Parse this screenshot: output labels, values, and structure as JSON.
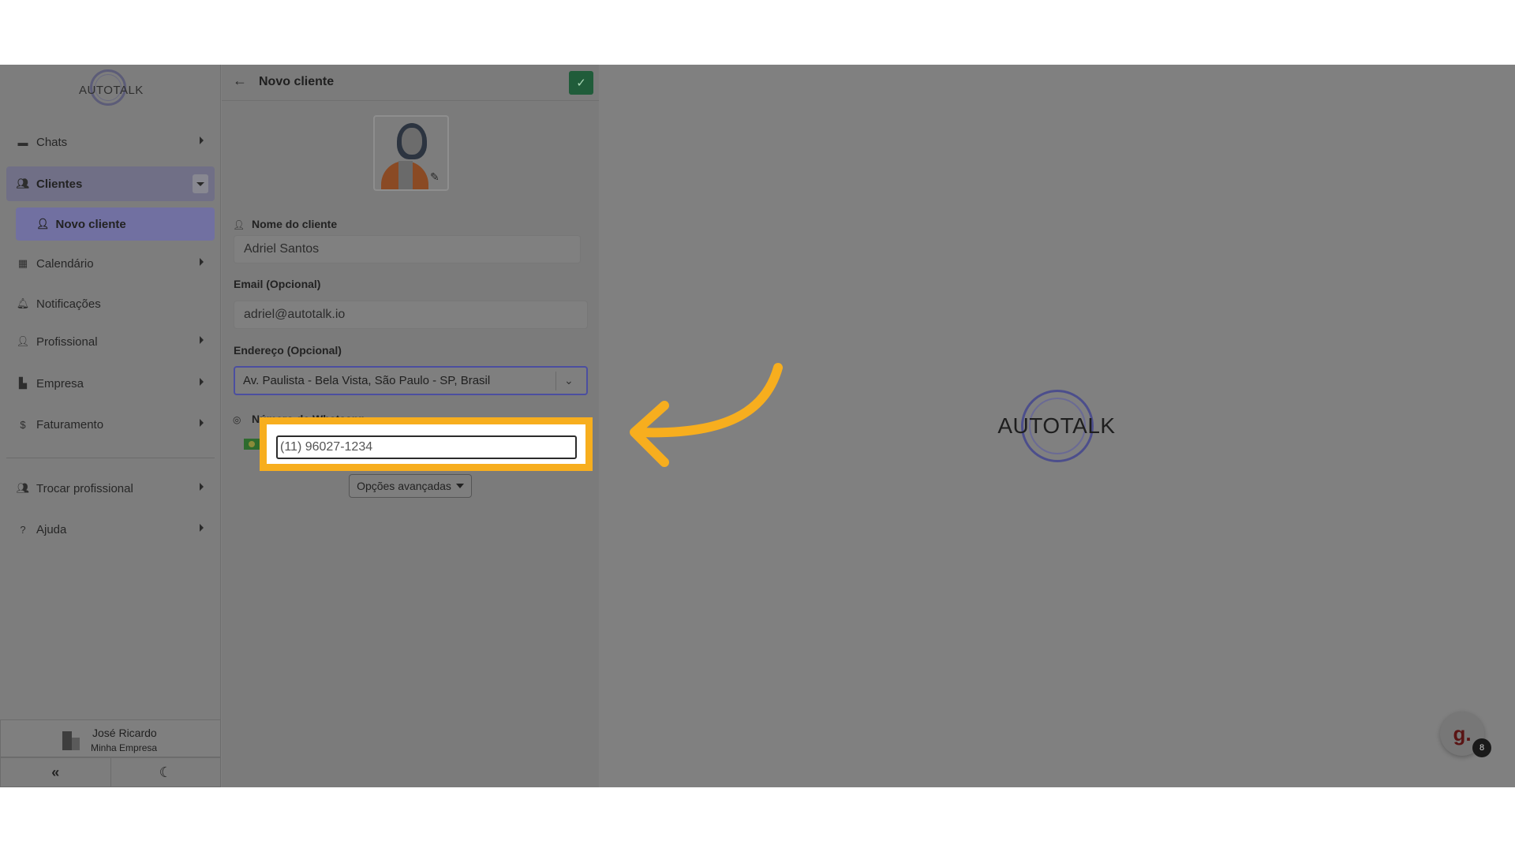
{
  "app": {
    "logo_text": "AUTOTALK"
  },
  "sidebar": {
    "items": [
      {
        "label": "Chats",
        "icon": "chat-icon"
      },
      {
        "label": "Clientes",
        "icon": "users-icon"
      },
      {
        "label": "Novo cliente",
        "icon": "user-plus-icon"
      },
      {
        "label": "Calendário",
        "icon": "calendar-icon"
      },
      {
        "label": "Notificações",
        "icon": "bell-icon"
      },
      {
        "label": "Profissional",
        "icon": "user-cog-icon"
      },
      {
        "label": "Empresa",
        "icon": "building-icon"
      },
      {
        "label": "Faturamento",
        "icon": "dollar-icon"
      },
      {
        "label": "Trocar profissional",
        "icon": "users-swap-icon"
      },
      {
        "label": "Ajuda",
        "icon": "question-icon"
      }
    ],
    "user": {
      "name": "José Ricardo",
      "company": "Minha Empresa"
    },
    "bottom": {
      "collapse_glyph": "«",
      "theme_glyph": "☾"
    }
  },
  "panel": {
    "title": "Novo cliente",
    "back_glyph": "←",
    "save_glyph": "✓",
    "name_label": "Nome do cliente",
    "name_value": "Adriel Santos",
    "email_label": "Email (Opcional)",
    "email_value": "adriel@autotalk.io",
    "address_label": "Endereço (Opcional)",
    "address_value": "Av. Paulista - Bela Vista, São Paulo - SP, Brasil",
    "whatsapp_label": "Número de Whatsapp",
    "phone_placeholder": "(11) 96027-1234",
    "advanced_label": "Opções avançadas"
  },
  "help": {
    "glyph": "g.",
    "badge": "8"
  },
  "colors": {
    "highlight": "#f7ae1e",
    "save_button": "#205c3a",
    "active_item": "#706f86"
  }
}
